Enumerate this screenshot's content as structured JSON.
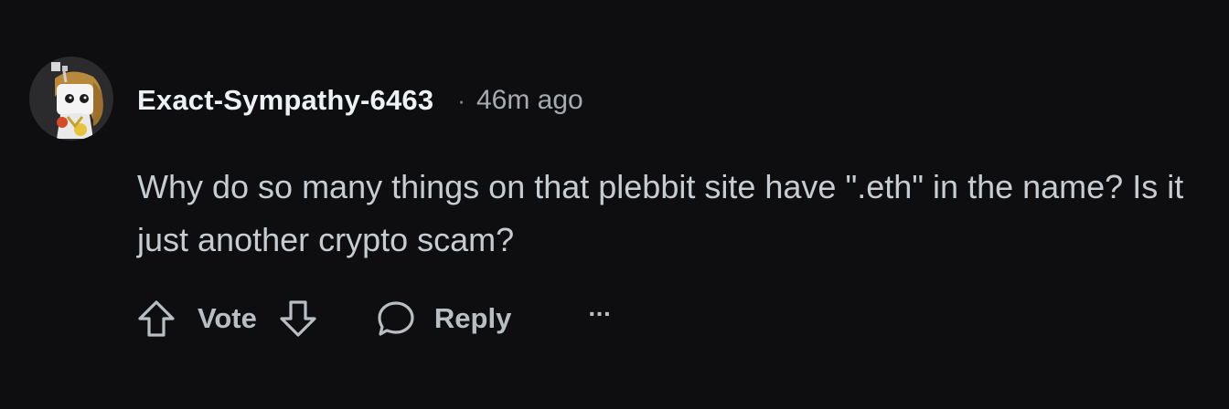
{
  "comment": {
    "username": "Exact-Sympathy-6463",
    "separator": "·",
    "timestamp": "46m ago",
    "text": "Why do so many things on that plebbit site have \".eth\" in the name? Is it just another crypto scam?",
    "avatar_icon": "snoo-avatar-icon"
  },
  "actions": {
    "upvote_icon": "arrow-up-icon",
    "vote_label": "Vote",
    "downvote_icon": "arrow-down-icon",
    "reply_icon": "speech-bubble-icon",
    "reply_label": "Reply",
    "more_label": "···"
  },
  "colors": {
    "background": "#0e0e10",
    "username": "#eef1f3",
    "body_text": "#c7ccd0",
    "muted": "#a6abaf"
  }
}
